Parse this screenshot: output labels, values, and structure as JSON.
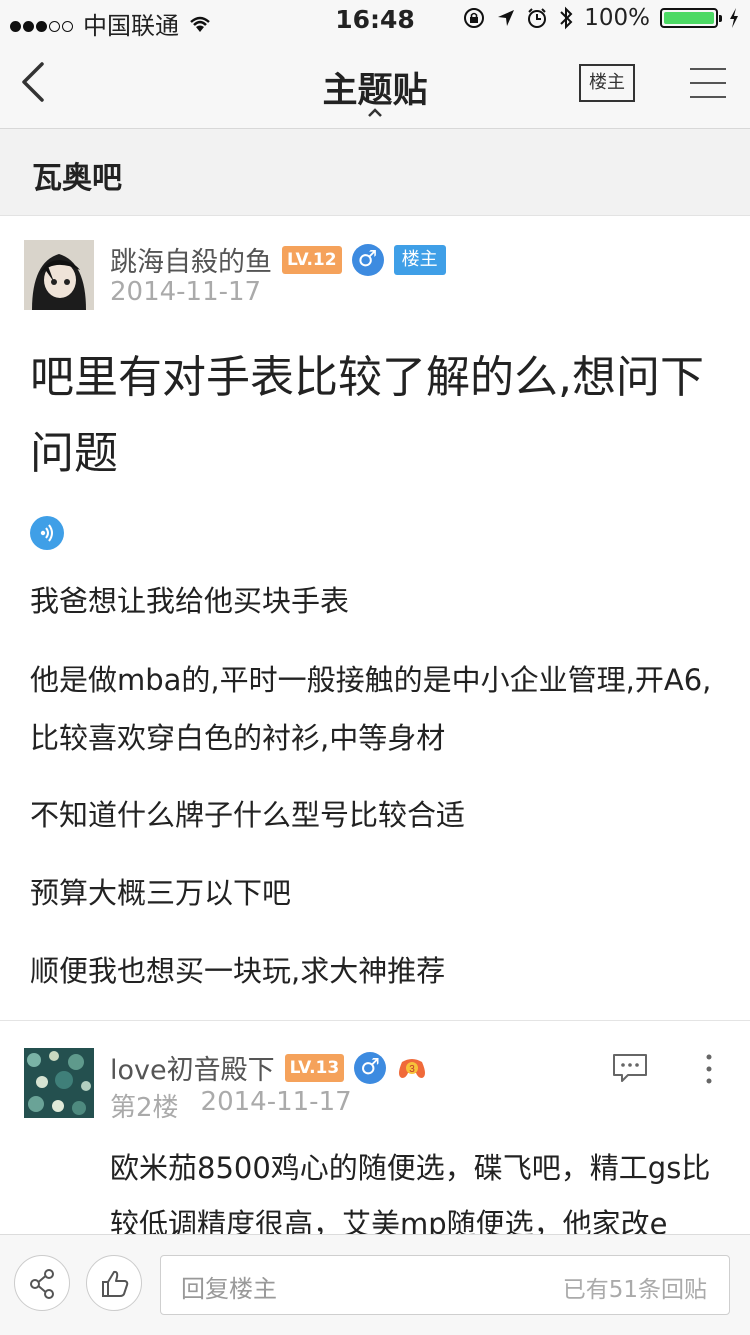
{
  "status_bar": {
    "carrier": "中国联通",
    "time": "16:48",
    "battery": "100%"
  },
  "nav": {
    "title": "主题贴",
    "louzhu_button": "楼主"
  },
  "forum": {
    "name": "瓦奥吧"
  },
  "post": {
    "author": "跳海自殺的鱼",
    "level": "LV.12",
    "op_badge": "楼主",
    "date": "2014-11-17",
    "title": "吧里有对手表比较了解的么,想问下问题",
    "paragraphs": [
      "我爸想让我给他买块手表",
      "他是做mba的,平时一般接触的是中小企业管理,开A6,比较喜欢穿白色的衬衫,中等身材",
      "不知道什么牌子什么型号比较合适",
      "预算大概三万以下吧",
      "顺便我也想买一块玩,求大神推荐"
    ]
  },
  "reply": {
    "author": "love初音殿下",
    "level": "LV.13",
    "floor": "第2楼",
    "date": "2014-11-17",
    "text": "欧米茄8500鸡心的随便选，碟飞吧，精工gs比较低调精度很高，艾美mp随便选，他家改e"
  },
  "bottom": {
    "reply_placeholder": "回复楼主",
    "reply_count": "已有51条回贴"
  },
  "colors": {
    "accent_blue": "#3f9fe7",
    "level_orange": "#f5a25b",
    "battery_green": "#4cd964"
  }
}
